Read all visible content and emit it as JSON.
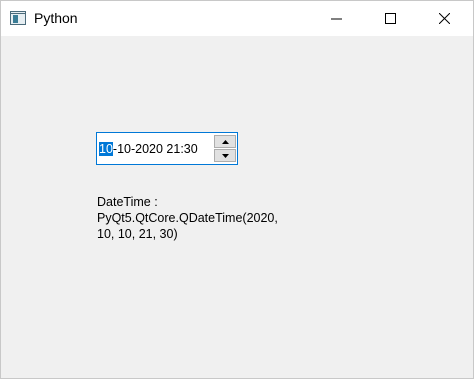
{
  "window": {
    "title": "Python",
    "app_icon": "python-window-icon",
    "controls": [
      "minimize-icon",
      "maximize-icon",
      "close-icon"
    ]
  },
  "datetime_edit": {
    "selected_part": "10",
    "rest": "-10-2020 21:30",
    "selection_color": "#0078d7",
    "focus_border_color": "#0078d7",
    "spin_up_icon": "arrow-up-icon",
    "spin_down_icon": "arrow-down-icon"
  },
  "label": {
    "line1": "DateTime :",
    "line2": "PyQt5.QtCore.QDateTime(2020,",
    "line3": "10, 10, 21, 30)"
  },
  "colors": {
    "background": "#f0f0f0",
    "titlebar": "#ffffff"
  }
}
